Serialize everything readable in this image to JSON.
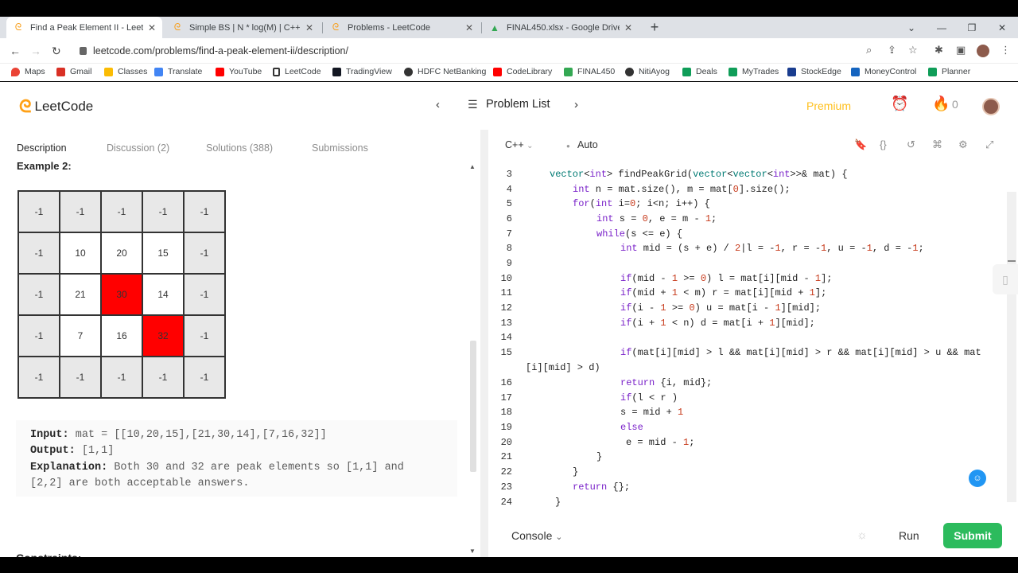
{
  "browser": {
    "tabs": [
      {
        "title": "Find a Peak Element II - LeetCode",
        "close": "✕"
      },
      {
        "title": "Simple BS | N * log(M) | C++ - Find",
        "close": "✕"
      },
      {
        "title": "Problems - LeetCode",
        "close": "✕"
      },
      {
        "title": "FINAL450.xlsx - Google Drive",
        "close": "✕"
      }
    ],
    "new_tab": "+",
    "url": "leetcode.com/problems/find-a-peak-element-ii/description/",
    "bookmarks": [
      "Maps",
      "Gmail",
      "Classes",
      "Translate",
      "YouTube",
      "LeetCode",
      "TradingView",
      "HDFC NetBanking",
      "CodeLibrary",
      "FINAL450",
      "NitiAyog",
      "Deals",
      "MyTrades",
      "StockEdge",
      "MoneyControl",
      "Planner"
    ]
  },
  "header": {
    "logo": "LeetCode",
    "problem_list": "Problem List",
    "premium": "Premium",
    "streak": "0"
  },
  "left": {
    "tabs": [
      "Description",
      "Discussion (2)",
      "Solutions (388)",
      "Submissions"
    ],
    "example_title": "Example 2:",
    "grid": [
      [
        "-1",
        "-1",
        "-1",
        "-1",
        "-1"
      ],
      [
        "-1",
        "10",
        "20",
        "15",
        "-1"
      ],
      [
        "-1",
        "21",
        "30",
        "14",
        "-1"
      ],
      [
        "-1",
        "7",
        "16",
        "32",
        "-1"
      ],
      [
        "-1",
        "-1",
        "-1",
        "-1",
        "-1"
      ]
    ],
    "input_label": "Input:",
    "input_value": "mat = [[10,20,15],[21,30,14],[7,16,32]]",
    "output_label": "Output:",
    "output_value": "[1,1]",
    "explanation_label": "Explanation:",
    "explanation_line1": "Both 30 and 32 are peak elements so [1,1] and",
    "explanation_line2": "[2,2] are both acceptable answers.",
    "constraints": "Constraints:"
  },
  "editor": {
    "language": "C++",
    "mode": "Auto",
    "line_numbers": [
      "3",
      "4",
      "5",
      "6",
      "7",
      "8",
      "9",
      "10",
      "11",
      "12",
      "13",
      "14",
      "15",
      "",
      "16",
      "17",
      "18",
      "19",
      "20",
      "21",
      "22",
      "23",
      "24"
    ]
  },
  "footer": {
    "console": "Console",
    "run": "Run",
    "submit": "Submit"
  },
  "colors": {
    "accent": "#ffa116",
    "submit": "#2cbb5d",
    "peak": "#ff0000",
    "premium": "#ffc01e"
  }
}
